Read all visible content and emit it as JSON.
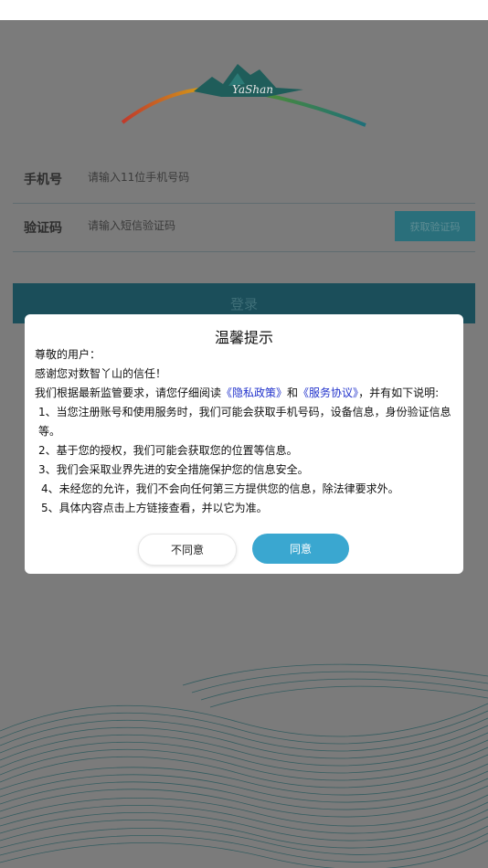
{
  "logo": {
    "text": "YaShan"
  },
  "form": {
    "phone_label": "手机号",
    "phone_placeholder": "请输入11位手机号码",
    "code_label": "验证码",
    "code_placeholder": "请输入短信验证码",
    "get_code_button": "获取验证码",
    "login_button": "登录"
  },
  "dialog": {
    "title": "温馨提示",
    "greeting": "尊敬的用户：",
    "thanks": "感谢您对数智丫山的信任！",
    "intro_prefix": "我们根据最新监管要求，请您仔细阅读",
    "privacy_link": "《隐私政策》",
    "and": "和",
    "service_link": "《服务协议》",
    "intro_suffix": "，并有如下说明:",
    "items": [
      "1、当您注册账号和使用服务时，我们可能会获取手机号码，设备信息，身份验证信息等。",
      "2、基于您的授权，我们可能会获取您的位置等信息。",
      "3、我们会采取业界先进的安全措施保护您的信息安全。",
      "4、未经您的允许，我们不会向任何第三方提供您的信息，除法律要求外。",
      "5、具体内容点击上方链接查看，并以它为准。"
    ],
    "disagree_button": "不同意",
    "agree_button": "同意"
  },
  "colors": {
    "overlay_bg": "#7b7b7b",
    "login_button": "#1b4e5a",
    "code_button": "#2a6f7b",
    "agree_button": "#3aa7d0",
    "link": "#2233cc"
  }
}
